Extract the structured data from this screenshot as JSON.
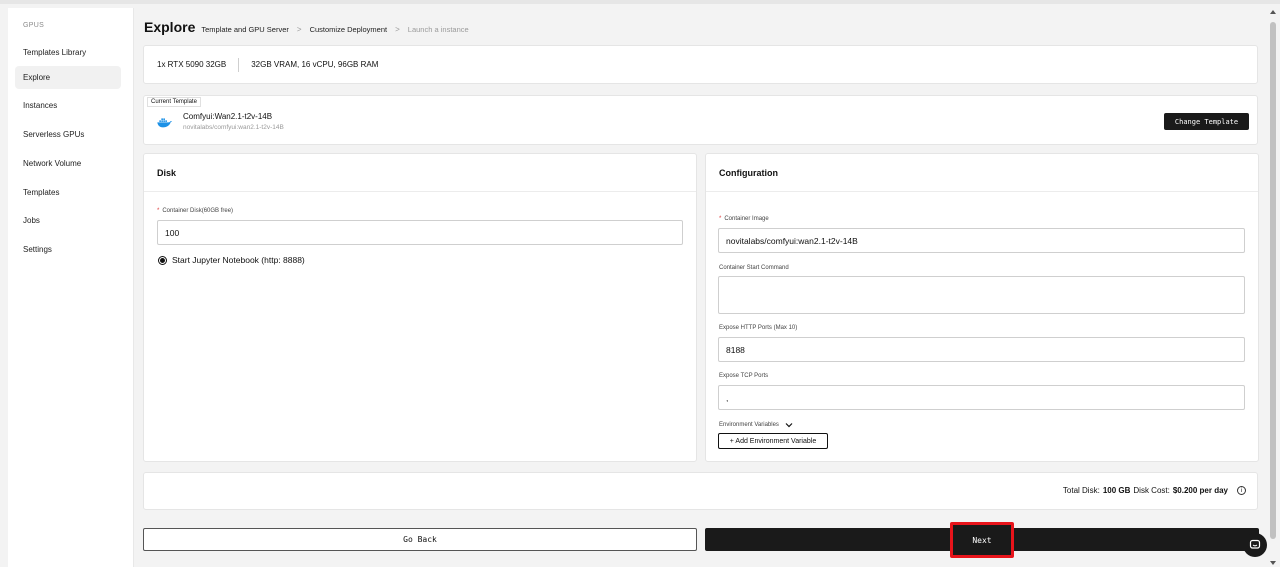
{
  "sidebar": {
    "section_label": "GPUS",
    "items": [
      {
        "label": "Templates Library",
        "active": false
      },
      {
        "label": "Explore",
        "active": true
      },
      {
        "label": "Instances",
        "active": false
      },
      {
        "label": "Serverless GPUs",
        "active": false
      },
      {
        "label": "Network Volume",
        "active": false
      },
      {
        "label": "Templates",
        "active": false
      },
      {
        "label": "Jobs",
        "active": false
      },
      {
        "label": "Settings",
        "active": false
      }
    ]
  },
  "header": {
    "title": "Explore",
    "breadcrumbs": [
      "Template and GPU Server",
      "Customize Deployment",
      "Launch a instance"
    ]
  },
  "gpu": {
    "name": "1x RTX 5090 32GB",
    "specs": "32GB VRAM, 16 vCPU, 96GB RAM"
  },
  "template": {
    "tag": "Current Template",
    "name": "Comfyui:Wan2.1-t2v-14B",
    "image": "novitalabs/comfyui:wan2.1-t2v-14B",
    "change_label": "Change Template",
    "logo_icon": "docker-icon",
    "logo_color": "#1d91e6"
  },
  "disk": {
    "title": "Disk",
    "container_disk_label": "Container Disk(60GB free)",
    "container_disk_value": "100",
    "jupyter_label": "Start Jupyter Notebook (http: 8888)",
    "jupyter_selected": true
  },
  "configuration": {
    "title": "Configuration",
    "image_label": "Container Image",
    "image_value": "novitalabs/comfyui:wan2.1-t2v-14B",
    "start_cmd_label": "Container Start Command",
    "start_cmd_value": "",
    "http_ports_label": "Expose HTTP Ports (Max 10)",
    "http_ports_value": "8188",
    "tcp_ports_label": "Expose TCP Ports",
    "tcp_ports_value": ",",
    "env_label": "Environment Variables",
    "add_env_label": "+ Add Environment Variable"
  },
  "summary": {
    "total_disk_label": "Total Disk:",
    "total_disk_value": "100 GB",
    "disk_cost_label": "Disk Cost:",
    "disk_cost_value": "$0.200 per day",
    "info_icon": "info-icon"
  },
  "actions": {
    "back_label": "Go Back",
    "next_label": "Next",
    "highlight_color": "#e8141b"
  },
  "chat": {
    "icon": "chat-icon"
  }
}
